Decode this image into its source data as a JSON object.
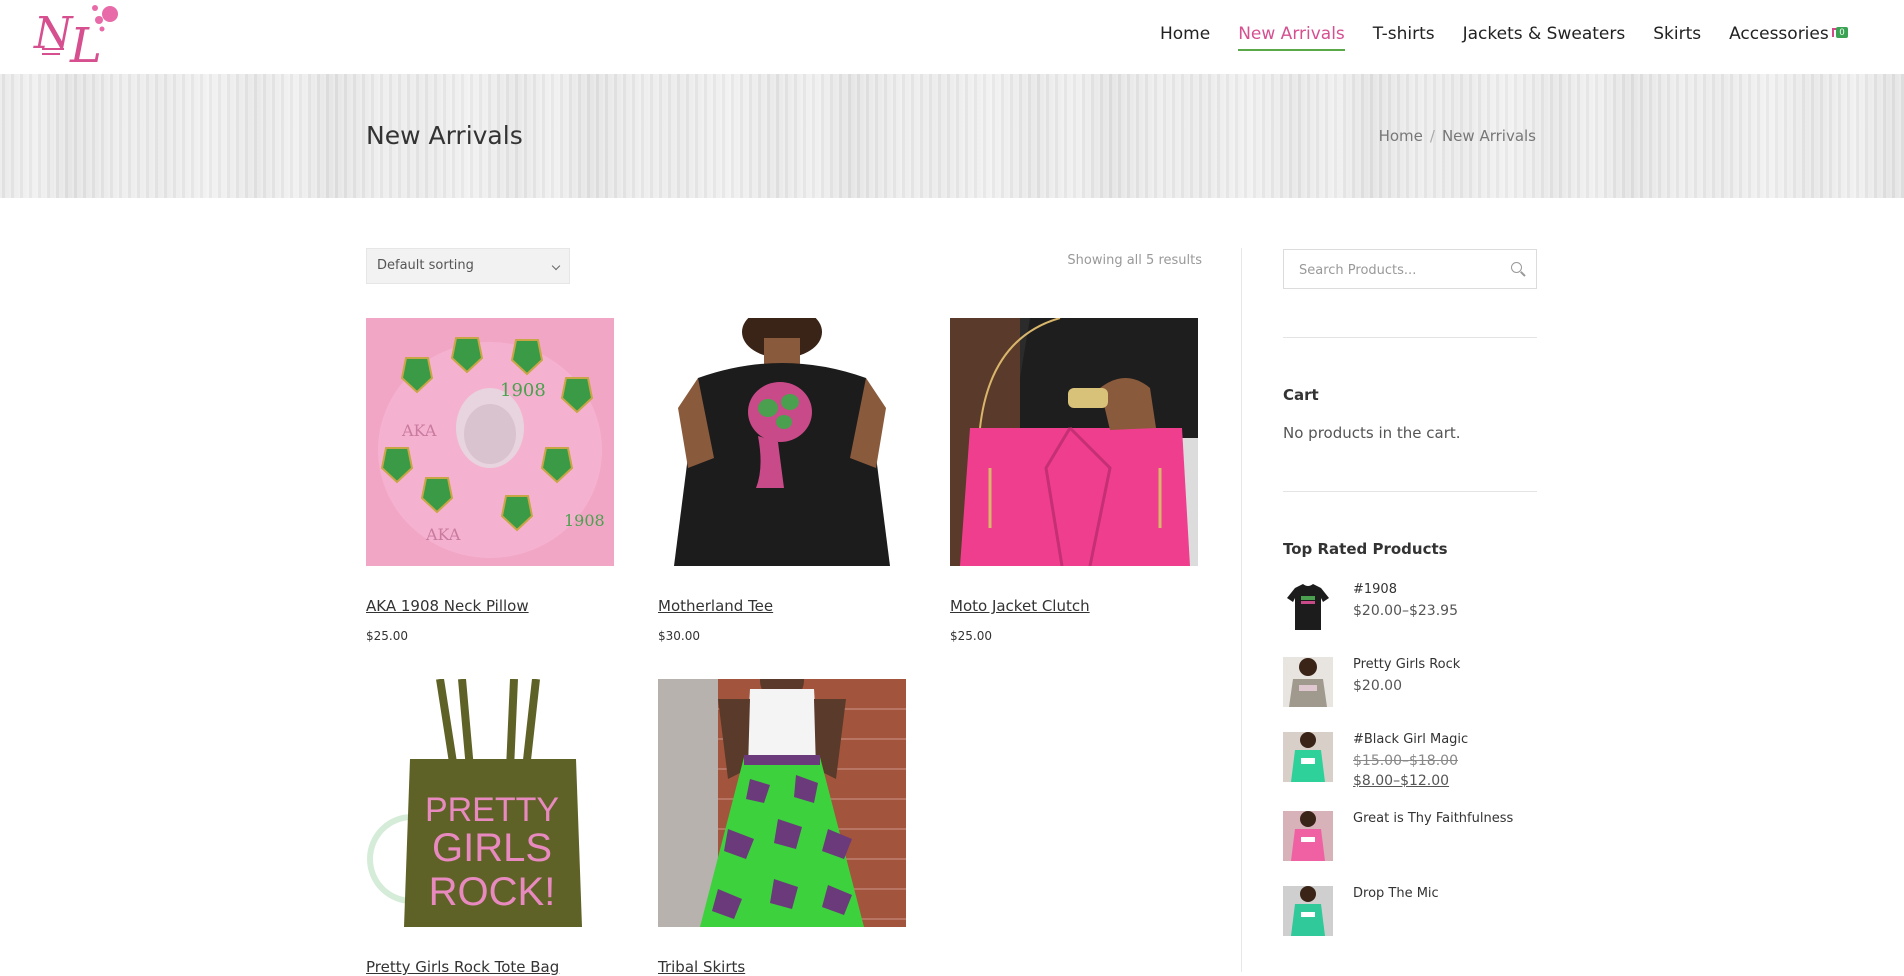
{
  "header": {
    "logo_alt": "NL",
    "nav": [
      "Home",
      "New Arrivals",
      "T-shirts",
      "Jackets & Sweaters",
      "Skirts",
      "Accessories"
    ],
    "active_nav": "New Arrivals",
    "cart_count": "0"
  },
  "title_bar": {
    "title": "New Arrivals",
    "breadcrumb": [
      "Home",
      "New Arrivals"
    ],
    "breadcrumb_sep": "/"
  },
  "shop": {
    "sorting": "Default sorting",
    "result_count": "Showing all 5 results",
    "products": [
      {
        "name": "AKA 1908 Neck Pillow",
        "price": "$25.00"
      },
      {
        "name": "Motherland Tee",
        "price": "$30.00"
      },
      {
        "name": "Moto Jacket Clutch",
        "price": "$25.00"
      },
      {
        "name": "Pretty Girls Rock Tote Bag",
        "price": ""
      },
      {
        "name": "Tribal Skirts",
        "price": ""
      }
    ],
    "product_image_text": {
      "pillow_year": "1908",
      "pillow_letters": "AKA",
      "tote_text": [
        "PRETTY",
        "GIRLS",
        "ROCK!"
      ]
    }
  },
  "sidebar": {
    "search_placeholder": "Search Products...",
    "cart_title": "Cart",
    "cart_empty": "No products in the cart.",
    "top_rated_title": "Top Rated Products",
    "top_rated": [
      {
        "name": "#1908",
        "price": "$20.00–$23.95"
      },
      {
        "name": "Pretty Girls Rock",
        "price": "$20.00"
      },
      {
        "name": "#Black Girl Magic",
        "price_old": "$15.00–$18.00",
        "price": "$8.00–$12.00"
      },
      {
        "name": "Great is Thy Faithfulness",
        "price": ""
      },
      {
        "name": "Drop The Mic",
        "price": ""
      }
    ]
  },
  "colors": {
    "accent_pink": "#d64f8f",
    "accent_green": "#59a84a"
  }
}
